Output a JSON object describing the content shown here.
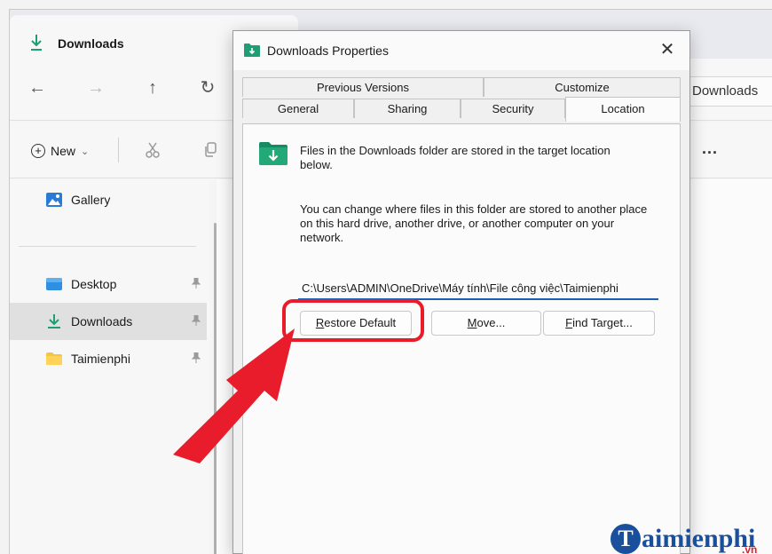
{
  "explorer": {
    "tab_title": "Downloads",
    "nav": {
      "back": "←",
      "forward": "→",
      "up": "↑",
      "refresh": "↻"
    },
    "address_text": "Downloads",
    "command": {
      "new_label": "New",
      "new_chevron": "⌄",
      "more": "..."
    },
    "sidebar": {
      "items": [
        {
          "label": "Gallery",
          "icon": "gallery-icon"
        },
        {
          "label": "Desktop",
          "icon": "desktop-icon",
          "pin": "📌"
        },
        {
          "label": "Downloads",
          "icon": "download-icon",
          "pin": "📌",
          "selected": true
        },
        {
          "label": "Taimienphi",
          "icon": "folder-icon",
          "pin": "📌"
        }
      ]
    }
  },
  "dialog": {
    "title": "Downloads Properties",
    "close": "✕",
    "tabs_back": [
      "Previous Versions",
      "Customize"
    ],
    "tabs_front": [
      "General",
      "Sharing",
      "Security",
      "Location"
    ],
    "active_tab": "Location",
    "description1": "Files in the Downloads folder are stored in the target location below.",
    "description2": "You can change where files in this folder are stored to another place on this hard drive, another drive, or another computer on your network.",
    "path_value": "C:\\Users\\ADMIN\\OneDrive\\Máy tính\\File công việc\\Taimienphi",
    "buttons": {
      "restore_default": {
        "mnemonic": "R",
        "rest": "estore Default"
      },
      "move": {
        "mnemonic": "M",
        "rest": "ove..."
      },
      "find_target": {
        "mnemonic": "F",
        "rest": "ind Target..."
      }
    }
  },
  "annotation": {
    "highlight_color": "#e81c2a"
  },
  "watermark": {
    "letter": "T",
    "text": "aimienphi",
    "suffix": ".vn"
  },
  "colors": {
    "accent": "#1a5fb4",
    "folder_teal": "#1f9d74",
    "highlight": "#e81c2a",
    "logo_blue": "#1a4f9c"
  }
}
